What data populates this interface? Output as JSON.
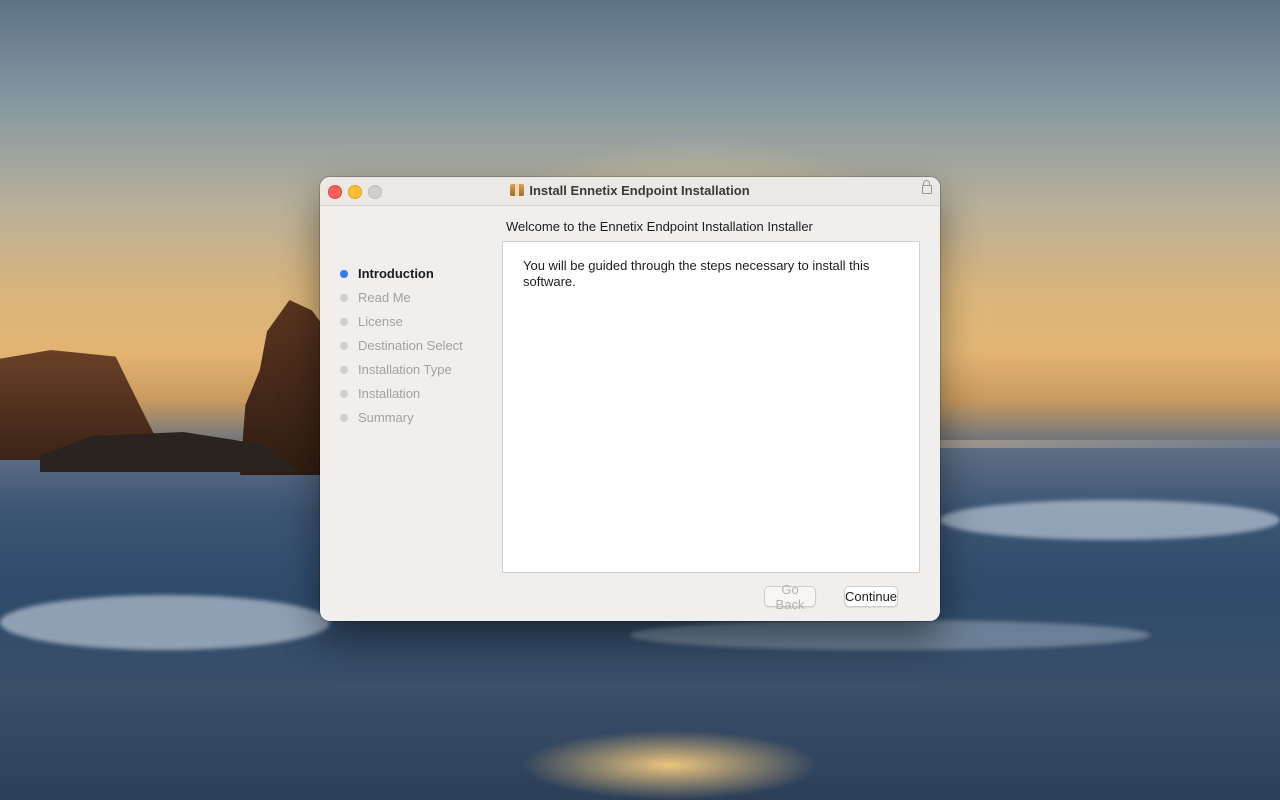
{
  "window": {
    "title": "Install Ennetix Endpoint Installation",
    "heading": "Welcome to the Ennetix Endpoint Installation Installer"
  },
  "steps": [
    {
      "label": "Introduction",
      "state": "active"
    },
    {
      "label": "Read Me",
      "state": "pending"
    },
    {
      "label": "License",
      "state": "pending"
    },
    {
      "label": "Destination Select",
      "state": "pending"
    },
    {
      "label": "Installation Type",
      "state": "pending"
    },
    {
      "label": "Installation",
      "state": "pending"
    },
    {
      "label": "Summary",
      "state": "pending"
    }
  ],
  "content": {
    "body": "You will be guided through the steps necessary to install this software."
  },
  "buttons": {
    "back_label": "Go Back",
    "back_enabled": false,
    "continue_label": "Continue"
  },
  "colors": {
    "active_step": "#3478f6",
    "close": "#fe5f57",
    "minimize": "#febc2e"
  },
  "icons": {
    "title_icon": "package-icon",
    "lock_icon": "lock-icon"
  }
}
